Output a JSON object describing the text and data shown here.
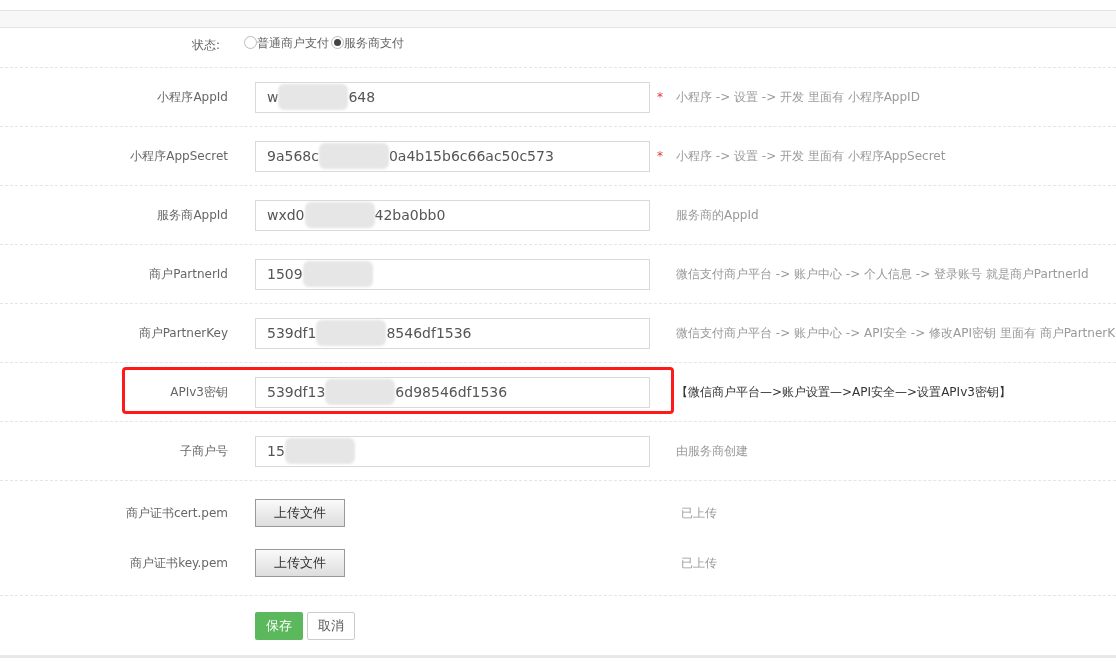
{
  "form": {
    "rows": [
      {
        "kind": "radio",
        "label": "状态:",
        "options": [
          {
            "label": "普通商户支付",
            "selected": false
          },
          {
            "label": "服务商支付",
            "selected": true
          }
        ]
      },
      {
        "kind": "text",
        "label": "小程序AppId",
        "value": "w",
        "value_end": "648",
        "required_mark": "*",
        "help": "小程序 -> 设置 -> 开发 里面有 小程序AppID",
        "highlighted": false
      },
      {
        "kind": "text",
        "label": "小程序AppSecret",
        "value": "9a568c",
        "value_end": "0a4b15b6c66ac50c573",
        "required_mark": "*",
        "help": "小程序 -> 设置 -> 开发 里面有 小程序AppSecret",
        "highlighted": false
      },
      {
        "kind": "text",
        "label": "服务商AppId",
        "value": "wxd0",
        "value_end": "42ba0bb0",
        "help": "服务商的AppId",
        "highlighted": false
      },
      {
        "kind": "text",
        "label": "商户PartnerId",
        "value": "1509",
        "help": "微信支付商户平台 -> 账户中心 -> 个人信息 -> 登录账号 就是商户PartnerId",
        "highlighted": false
      },
      {
        "kind": "text",
        "label": "商户PartnerKey",
        "value": "539df1",
        "value_end": "8546df1536",
        "help": "微信支付商户平台 -> 账户中心 -> API安全 -> 修改API密钥 里面有 商户PartnerK",
        "highlighted": false
      },
      {
        "kind": "text",
        "label": "APIv3密钥",
        "value": "539df13",
        "value_end": "6d98546df1536",
        "help": "【微信商户平台—>账户设置—>API安全—>设置APIv3密钥】",
        "highlighted": true
      },
      {
        "kind": "text",
        "label": "子商户号",
        "value": "15",
        "help": "由服务商创建",
        "highlighted": false
      },
      {
        "kind": "file",
        "label": "商户证书cert.pem",
        "button": "上传文件",
        "status": "已上传"
      },
      {
        "kind": "file",
        "label": "商户证书key.pem",
        "button": "上传文件",
        "status": "已上传"
      }
    ],
    "buttons": [
      {
        "label": "保存",
        "kind": "primary"
      },
      {
        "label": "取消",
        "kind": "default"
      }
    ]
  }
}
